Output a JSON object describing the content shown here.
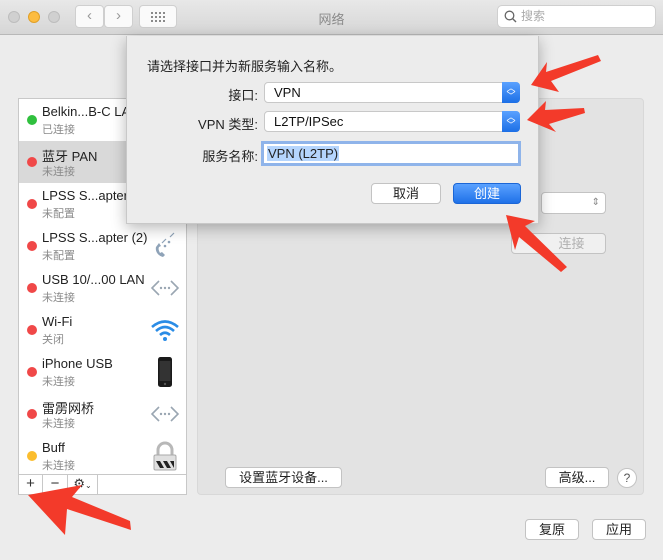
{
  "window": {
    "title": "网络",
    "search_placeholder": "搜索",
    "nav_back": "‹",
    "nav_forward": "›"
  },
  "sidebar": {
    "services": [
      {
        "name": "Belkin...B-C LAN",
        "status": "已连接",
        "dot_color": "#30c03e",
        "icon": "none",
        "selected": false
      },
      {
        "name": "蓝牙 PAN",
        "status": "未连接",
        "dot_color": "#f04848",
        "icon": "none",
        "selected": true
      },
      {
        "name": "LPSS S...apter",
        "status": "未配置",
        "dot_color": "#f04848",
        "icon": "none",
        "selected": false
      },
      {
        "name": "LPSS S...apter (2)",
        "status": "未配置",
        "dot_color": "#f04848",
        "icon": "phone-modem-icon",
        "selected": false
      },
      {
        "name": "USB 10/...00 LAN",
        "status": "未连接",
        "dot_color": "#f04848",
        "icon": "ethernet-icon",
        "selected": false
      },
      {
        "name": "Wi-Fi",
        "status": "关闭",
        "dot_color": "#f04848",
        "icon": "wifi-icon",
        "selected": false
      },
      {
        "name": "iPhone USB",
        "status": "未连接",
        "dot_color": "#f04848",
        "icon": "iphone-icon",
        "selected": false
      },
      {
        "name": "雷雳网桥",
        "status": "未连接",
        "dot_color": "#f04848",
        "icon": "ethernet-icon",
        "selected": false
      },
      {
        "name": "Buff",
        "status": "未连接",
        "dot_color": "#fbbd2e",
        "icon": "vpn-lock-icon",
        "selected": false
      }
    ],
    "tools": {
      "add": "+",
      "remove": "−",
      "gear": "⚙"
    }
  },
  "panel": {
    "connect_button": "连接",
    "setup_bluetooth_button": "设置蓝牙设备...",
    "advanced_button": "高级...",
    "help_button": "?"
  },
  "footer": {
    "revert_button": "复原",
    "apply_button": "应用"
  },
  "sheet": {
    "prompt": "请选择接口并为新服务输入名称。",
    "interface_label": "接口:",
    "interface_value": "VPN",
    "vpn_type_label": "VPN 类型:",
    "vpn_type_value": "L2TP/IPSec",
    "service_name_label": "服务名称:",
    "service_name_value": "VPN (L2TP)",
    "cancel_button": "取消",
    "create_button": "创建"
  },
  "annotation_color": "#f33a2a"
}
